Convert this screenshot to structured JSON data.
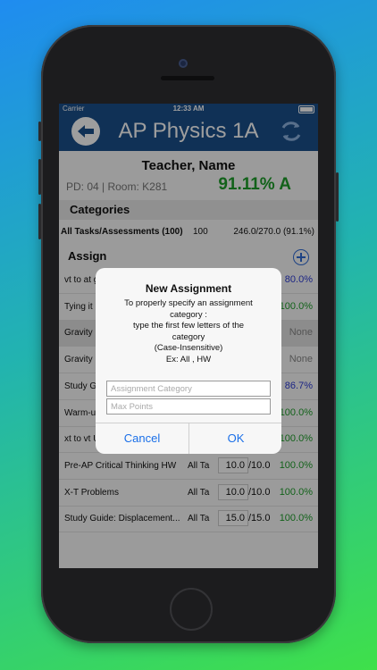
{
  "status": {
    "carrier": "Carrier",
    "time": "12:33 AM"
  },
  "nav": {
    "title": "AP Physics 1A",
    "back_icon": "arrow-left-icon",
    "refresh_icon": "refresh-icon"
  },
  "teacher": {
    "name": "Teacher, Name",
    "pd_room": "PD: 04 | Room: K281",
    "grade": "91.11% A"
  },
  "categories": {
    "header": "Categories",
    "row": {
      "name": "All Tasks/Assessments (100)",
      "count": "100",
      "score": "246.0/270.0 (91.1%)"
    }
  },
  "assignments": {
    "header": "Assign",
    "rows": [
      {
        "name": "vt to at g",
        "cat": "",
        "earned": "",
        "denom": "",
        "pct": "80.0%",
        "color": "blue",
        "dark": false
      },
      {
        "name": "Tying it",
        "cat": "",
        "earned": "",
        "denom": "",
        "pct": "100.0%",
        "color": "green",
        "dark": false
      },
      {
        "name": "Gravity",
        "cat": "",
        "earned": "",
        "denom": "",
        "pct": "None",
        "color": "gray",
        "dark": true
      },
      {
        "name": "Gravity",
        "cat": "",
        "earned": "",
        "denom": "",
        "pct": "None",
        "color": "gray",
        "dark": false
      },
      {
        "name": "Study G",
        "cat": "",
        "earned": "",
        "denom": "",
        "pct": "86.7%",
        "color": "blue",
        "dark": false
      },
      {
        "name": "Warm-u",
        "cat": "",
        "earned": "",
        "denom": "",
        "pct": "100.0%",
        "color": "green",
        "dark": false
      },
      {
        "name": "xt to vt Unit Test",
        "cat": "All T",
        "earned": "40.0",
        "denom": "/40.0",
        "pct": "100.0%",
        "color": "green",
        "dark": false
      },
      {
        "name": "Pre-AP Critical Thinking HW",
        "cat": "All Ta",
        "earned": "10.0",
        "denom": "/10.0",
        "pct": "100.0%",
        "color": "green",
        "dark": false
      },
      {
        "name": "X-T Problems",
        "cat": "All Ta",
        "earned": "10.0",
        "denom": "/10.0",
        "pct": "100.0%",
        "color": "green",
        "dark": false
      },
      {
        "name": "Study Guide: Displacement...",
        "cat": "All Ta",
        "earned": "15.0",
        "denom": "/15.0",
        "pct": "100.0%",
        "color": "green",
        "dark": false
      }
    ]
  },
  "dialog": {
    "title": "New Assignment",
    "message_lines": [
      "To properly specify an assignment",
      "category :",
      "type the first few letters of the",
      "category",
      "(Case-Insensitive)",
      "Ex: All , HW"
    ],
    "category_placeholder": "Assignment Category",
    "points_placeholder": "Max Points",
    "cancel_label": "Cancel",
    "ok_label": "OK"
  },
  "colors": {
    "nav": "#1a4f8c",
    "grade": "#1e9e2a",
    "link": "#1a6fe8"
  }
}
